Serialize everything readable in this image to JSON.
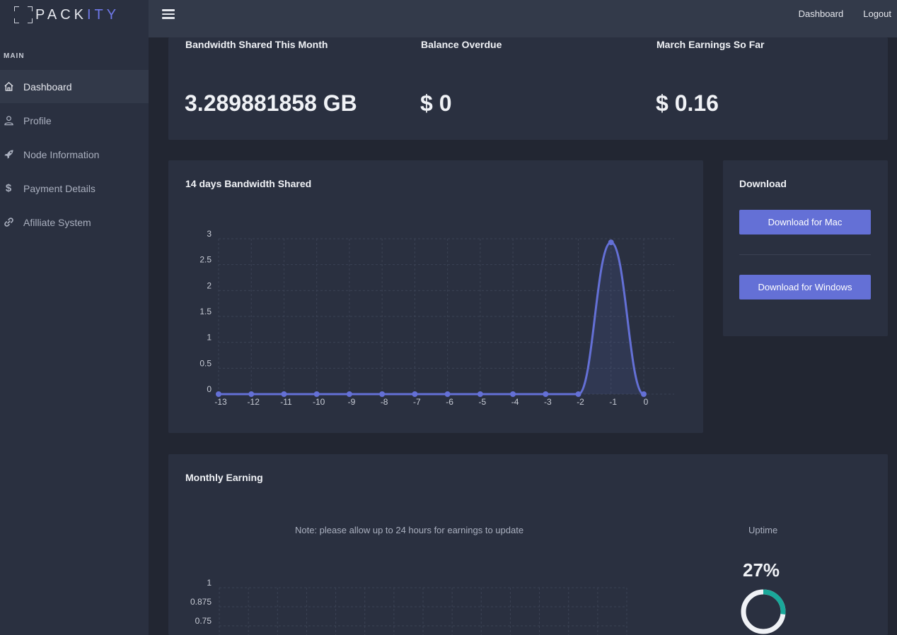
{
  "brand": {
    "part1": "PACK",
    "part2": "ITY"
  },
  "sidebar": {
    "section": "MAIN",
    "items": [
      {
        "label": "Dashboard",
        "icon": "home-icon",
        "active": true
      },
      {
        "label": "Profile",
        "icon": "user-icon",
        "active": false
      },
      {
        "label": "Node Information",
        "icon": "rocket-icon",
        "active": false
      },
      {
        "label": "Payment Details",
        "icon": "dollar-icon",
        "active": false
      },
      {
        "label": "Afilliate System",
        "icon": "link-icon",
        "active": false
      }
    ]
  },
  "topbar": {
    "dashboard_link": "Dashboard",
    "logout_link": "Logout"
  },
  "stats": [
    {
      "label": "Bandwidth Shared This Month",
      "value": "3.289881858 GB"
    },
    {
      "label": "Balance Overdue",
      "value": "$ 0"
    },
    {
      "label": "March Earnings So Far",
      "value": "$ 0.16"
    }
  ],
  "download": {
    "title": "Download",
    "mac_label": "Download for Mac",
    "windows_label": "Download for Windows"
  },
  "bandwidth_card": {
    "title": "14 days Bandwidth Shared"
  },
  "monthly": {
    "title": "Monthly Earning",
    "note": "Note: please allow up to 24 hours for earnings to update",
    "uptime_label": "Uptime",
    "uptime_value": "27%",
    "uptime_fraction": 0.27
  },
  "colors": {
    "accent": "#6470d6",
    "line": "#6470d6",
    "uptime_ring": "#1aa89a",
    "background": "#222632",
    "card": "#2a3040"
  },
  "chart_data": [
    {
      "type": "line",
      "x": [
        -13,
        -12,
        -11,
        -10,
        -9,
        -8,
        -7,
        -6,
        -5,
        -4,
        -3,
        -2,
        -1,
        0
      ],
      "x_ticks": [
        "-13",
        "-12",
        "-11",
        "-10",
        "-9",
        "-8",
        "-7",
        "-6",
        "-5",
        "-4",
        "-3",
        "-2",
        "-1",
        "0"
      ],
      "series": [
        {
          "values": [
            0,
            0,
            0,
            0,
            0,
            0,
            0,
            0,
            0,
            0,
            0,
            0,
            2.93,
            0
          ]
        }
      ],
      "y_ticks": [
        "0",
        "0.5",
        "1",
        "1.5",
        "2",
        "2.5",
        "3"
      ],
      "ylim": [
        0,
        3
      ],
      "grid": true
    },
    {
      "type": "line",
      "y_ticks": [
        "0.75",
        "0.875",
        "1"
      ],
      "grid": true
    }
  ]
}
